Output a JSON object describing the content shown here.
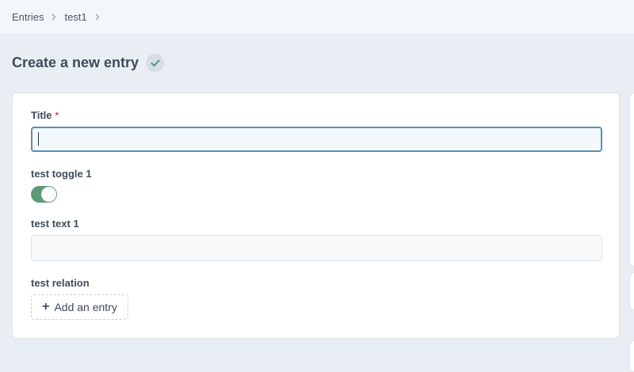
{
  "breadcrumb": {
    "items": [
      "Entries",
      "test1"
    ]
  },
  "header": {
    "title": "Create a new entry",
    "status_icon": "check-icon"
  },
  "form": {
    "title_field": {
      "label": "Title",
      "required_mark": "*",
      "value": ""
    },
    "toggle_field": {
      "label": "test toggle 1",
      "checked": true
    },
    "text_field": {
      "label": "test text 1",
      "value": ""
    },
    "relation_field": {
      "label": "test relation",
      "add_label": "Add an entry"
    }
  },
  "colors": {
    "accent": "#5b8db8",
    "toggle_on": "#5c9a78",
    "check": "#5c9a78",
    "required": "#d9534f"
  }
}
